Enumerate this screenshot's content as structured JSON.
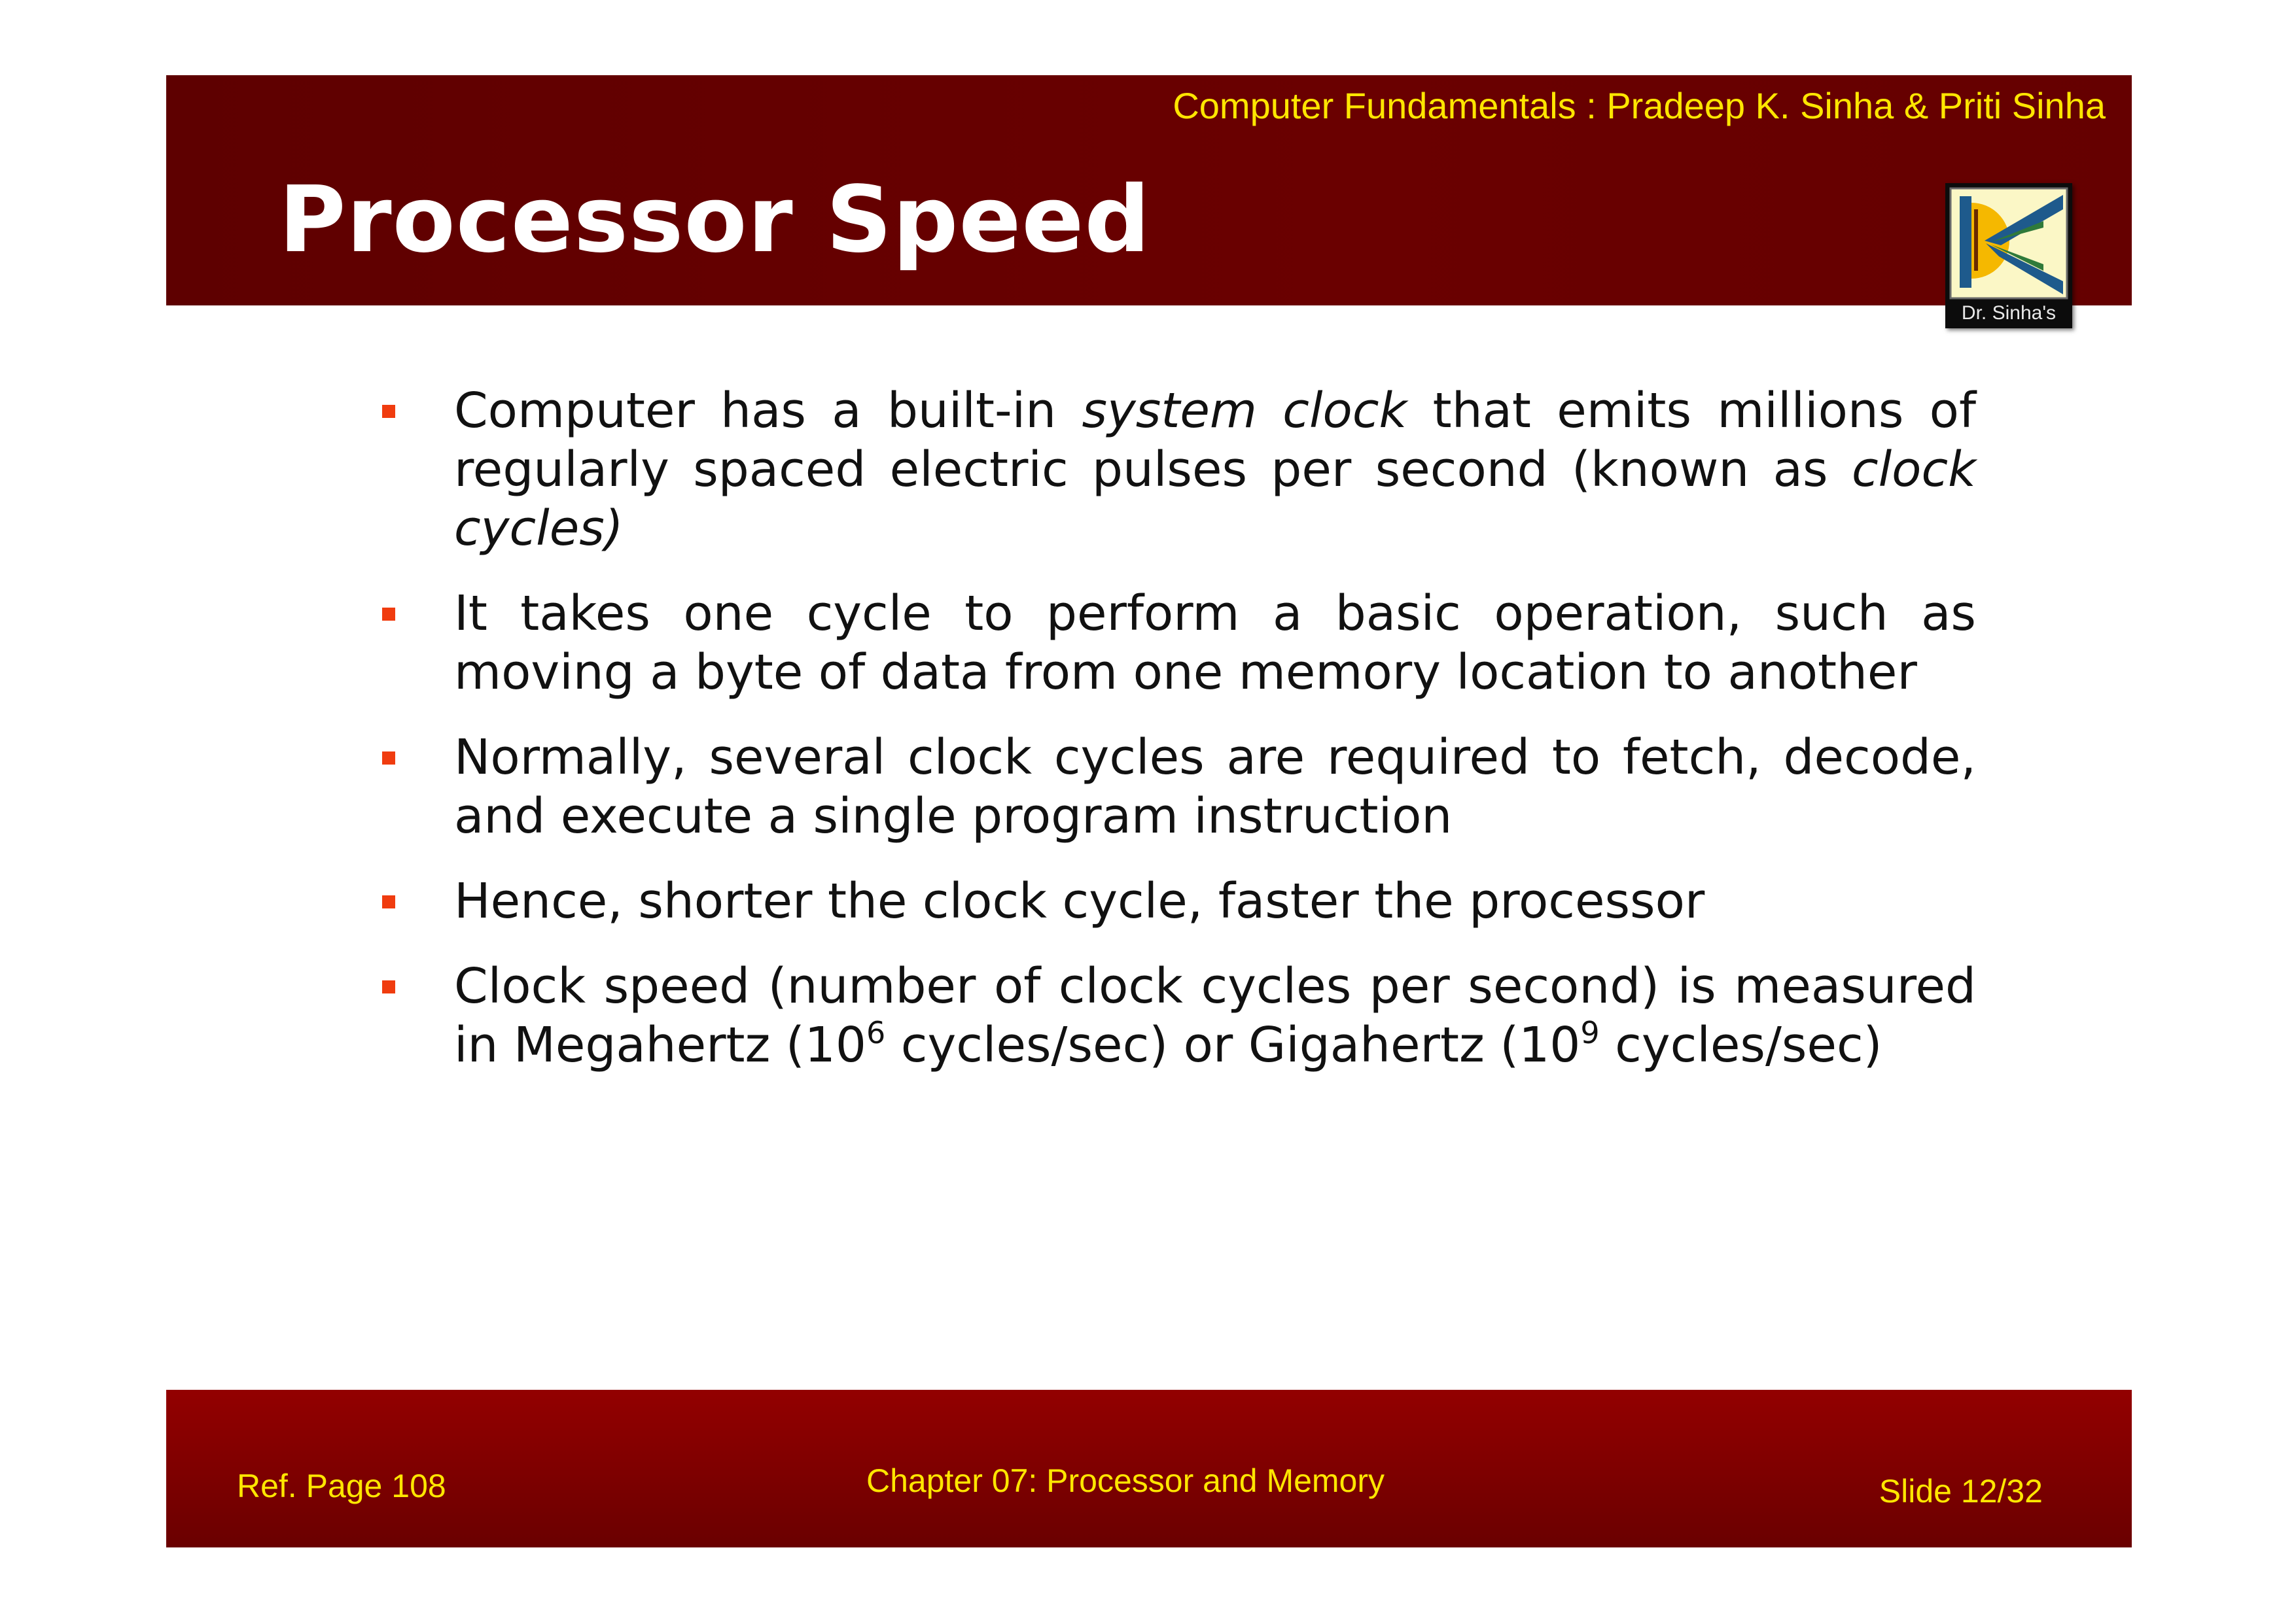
{
  "header": {
    "book_credit": "Computer Fundamentals : Pradeep K. Sinha & Priti Sinha",
    "title": "Processor Speed",
    "logo": {
      "icon": "dr-sinhas-logo-icon",
      "caption": "Dr. Sinha's"
    }
  },
  "bullets": [
    {
      "parts": [
        {
          "text": "Computer has a built-in ",
          "italic": false
        },
        {
          "text": "system clock",
          "italic": true
        },
        {
          "text": " that emits millions of regularly spaced electric pulses per second (known as ",
          "italic": false
        },
        {
          "text": "clock cycles)",
          "italic": true
        }
      ]
    },
    {
      "parts": [
        {
          "text": "It takes one cycle to perform a basic operation, such as moving a byte of data from one memory location to another",
          "italic": false
        }
      ]
    },
    {
      "parts": [
        {
          "text": "Normally, several clock cycles are required to fetch, decode, and execute a single program instruction",
          "italic": false
        }
      ]
    },
    {
      "parts": [
        {
          "text": "Hence, shorter the clock cycle, faster the processor",
          "italic": false
        }
      ]
    },
    {
      "parts": [
        {
          "text": "Clock speed (number of clock cycles per second) is measured in Megahertz (10",
          "italic": false
        },
        {
          "text": "6",
          "sup": true
        },
        {
          "text": " cycles/sec) or Gigahertz (10",
          "italic": false
        },
        {
          "text": "9",
          "sup": true
        },
        {
          "text": " cycles/sec)",
          "italic": false
        }
      ]
    }
  ],
  "footer": {
    "ref_page": "Ref. Page  108",
    "chapter": "Chapter 07: Processor and Memory",
    "slide": "Slide 12/32"
  },
  "colors": {
    "header_band": "#640000",
    "footer_band": "#8a0000",
    "accent_text": "#ffe600",
    "bullet_marker": "#f03c0f"
  }
}
